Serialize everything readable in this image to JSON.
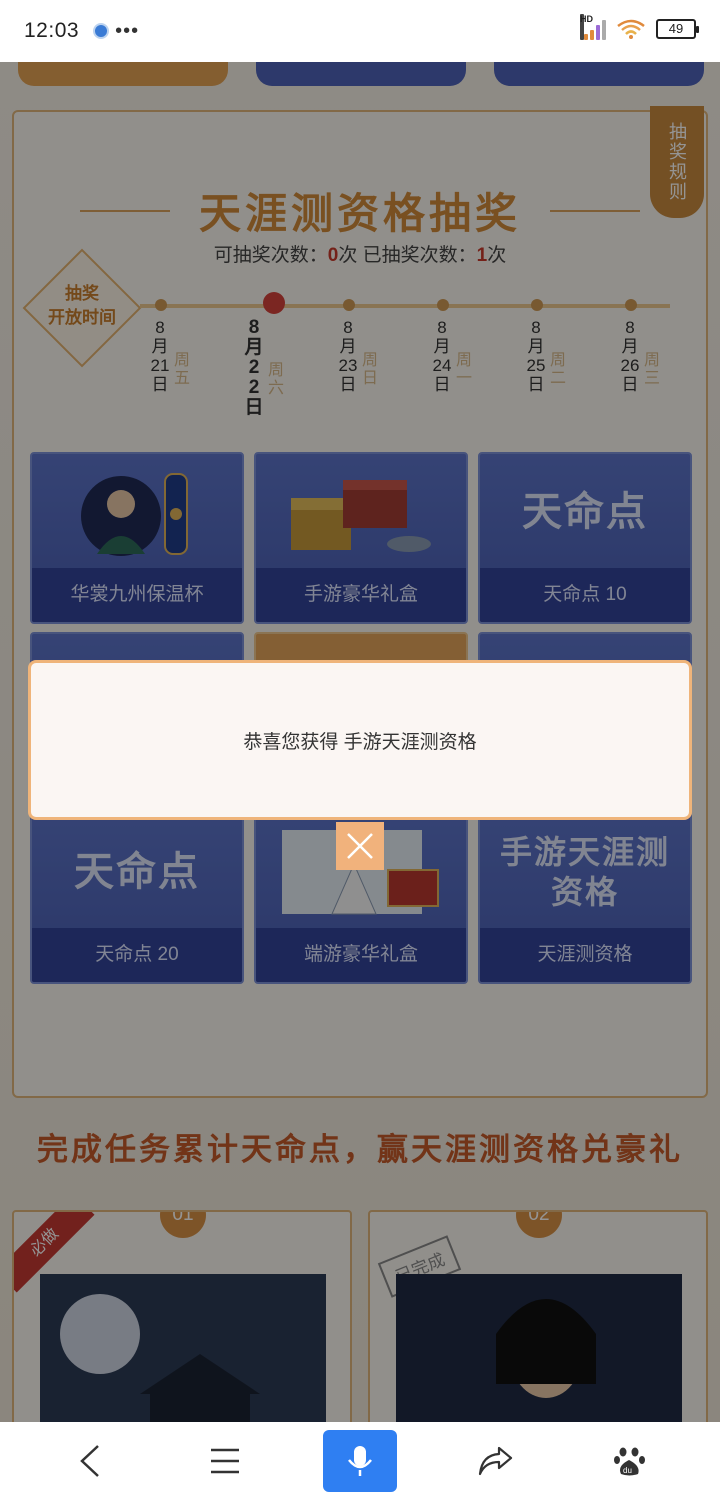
{
  "status_bar": {
    "time": "12:03",
    "more": "•••",
    "signal_label": "HD",
    "battery": "49"
  },
  "lottery": {
    "rule_tag": "抽奖规则",
    "title": "天涯测资格抽奖",
    "counter": {
      "remaining_label": "可抽奖次数：",
      "remaining_value": "0",
      "remaining_unit": "次",
      "used_label": "已抽奖次数：",
      "used_value": "1",
      "used_unit": "次"
    },
    "timeline_badge": [
      "抽奖",
      "开放时间"
    ],
    "dates": [
      {
        "date": "8月21日",
        "week": "周五",
        "active": false
      },
      {
        "date": "8月22日",
        "week": "周六",
        "active": true
      },
      {
        "date": "8月23日",
        "week": "周日",
        "active": false
      },
      {
        "date": "8月24日",
        "week": "周一",
        "active": false
      },
      {
        "date": "8月25日",
        "week": "周二",
        "active": false
      },
      {
        "date": "8月26日",
        "week": "周三",
        "active": false
      }
    ],
    "prizes": [
      {
        "label": "华裳九州保温杯",
        "art": "cup-art"
      },
      {
        "label": "手游豪华礼盒",
        "art": "giftbox-art"
      },
      {
        "label": "天命点 10",
        "art": "text-art",
        "art_text": "天命点"
      },
      {
        "label": "天命点 20",
        "art": "text-art",
        "art_text": "天命点"
      },
      {
        "label": "端游豪华礼盒",
        "art": "character-art"
      },
      {
        "label": "天涯测资格",
        "art": "text-art",
        "art_text": "手游天涯测资格"
      }
    ]
  },
  "tasks": {
    "title": "完成任务累计天命点，赢天涯测资格兑豪礼",
    "cards": [
      {
        "number": "01",
        "ribbon": "必做"
      },
      {
        "number": "02",
        "stamp": "已完成"
      }
    ]
  },
  "dialog": {
    "message": "恭喜您获得 手游天涯测资格",
    "close_icon": "close-icon"
  },
  "bottom_nav": {
    "items": [
      {
        "name": "back-button",
        "icon": "chevron-left-icon"
      },
      {
        "name": "menu-button",
        "icon": "menu-icon"
      },
      {
        "name": "voice-button",
        "icon": "microphone-icon"
      },
      {
        "name": "share-button",
        "icon": "share-icon"
      },
      {
        "name": "baidu-button",
        "icon": "baidu-paw-icon"
      }
    ]
  },
  "colors": {
    "accent": "#2f7ff2",
    "dialog_border": "#efb47a",
    "prize_bg": "#4a5fb3",
    "title_gold": "#d08a3a"
  }
}
